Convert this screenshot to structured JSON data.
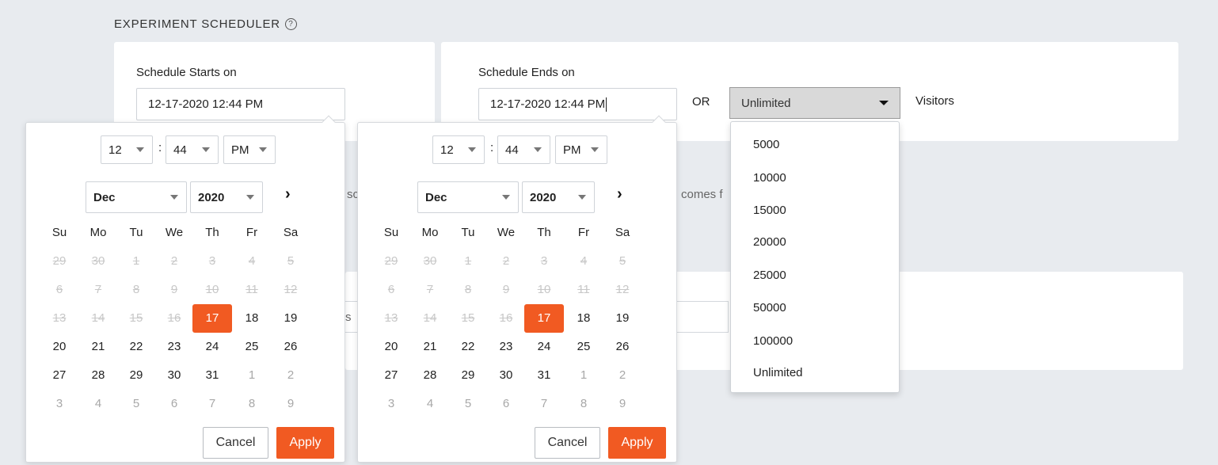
{
  "section": {
    "title": "EXPERIMENT SCHEDULER",
    "help_icon": "?"
  },
  "start": {
    "label": "Schedule Starts on",
    "value": "12-17-2020 12:44 PM"
  },
  "end": {
    "label": "Schedule Ends on",
    "value": "12-17-2020 12:44 PM"
  },
  "or_label": "OR",
  "visitors": {
    "selected": "Unlimited",
    "label": "Visitors",
    "options": [
      "5000",
      "10000",
      "15000",
      "20000",
      "25000",
      "50000",
      "100000",
      "Unlimited"
    ]
  },
  "background_text": {
    "left_fragment": "sc",
    "right_fragment": "comes f",
    "lower_fragment": "s"
  },
  "picker": {
    "hour": "12",
    "minute": "44",
    "ampm": "PM",
    "colon": ":",
    "month": "Dec",
    "year": "2020",
    "next_icon": "›",
    "weekdays": [
      "Su",
      "Mo",
      "Tu",
      "We",
      "Th",
      "Fr",
      "Sa"
    ],
    "weeks": [
      [
        "29",
        "30",
        "1",
        "2",
        "3",
        "4",
        "5"
      ],
      [
        "6",
        "7",
        "8",
        "9",
        "10",
        "11",
        "12"
      ],
      [
        "13",
        "14",
        "15",
        "16",
        "17",
        "18",
        "19"
      ],
      [
        "20",
        "21",
        "22",
        "23",
        "24",
        "25",
        "26"
      ],
      [
        "27",
        "28",
        "29",
        "30",
        "31",
        "1",
        "2"
      ],
      [
        "3",
        "4",
        "5",
        "6",
        "7",
        "8",
        "9"
      ]
    ],
    "selected_day": "17",
    "cancel_label": "Cancel",
    "apply_label": "Apply"
  },
  "colors": {
    "accent": "#f15a22",
    "background": "#e8ebef"
  }
}
